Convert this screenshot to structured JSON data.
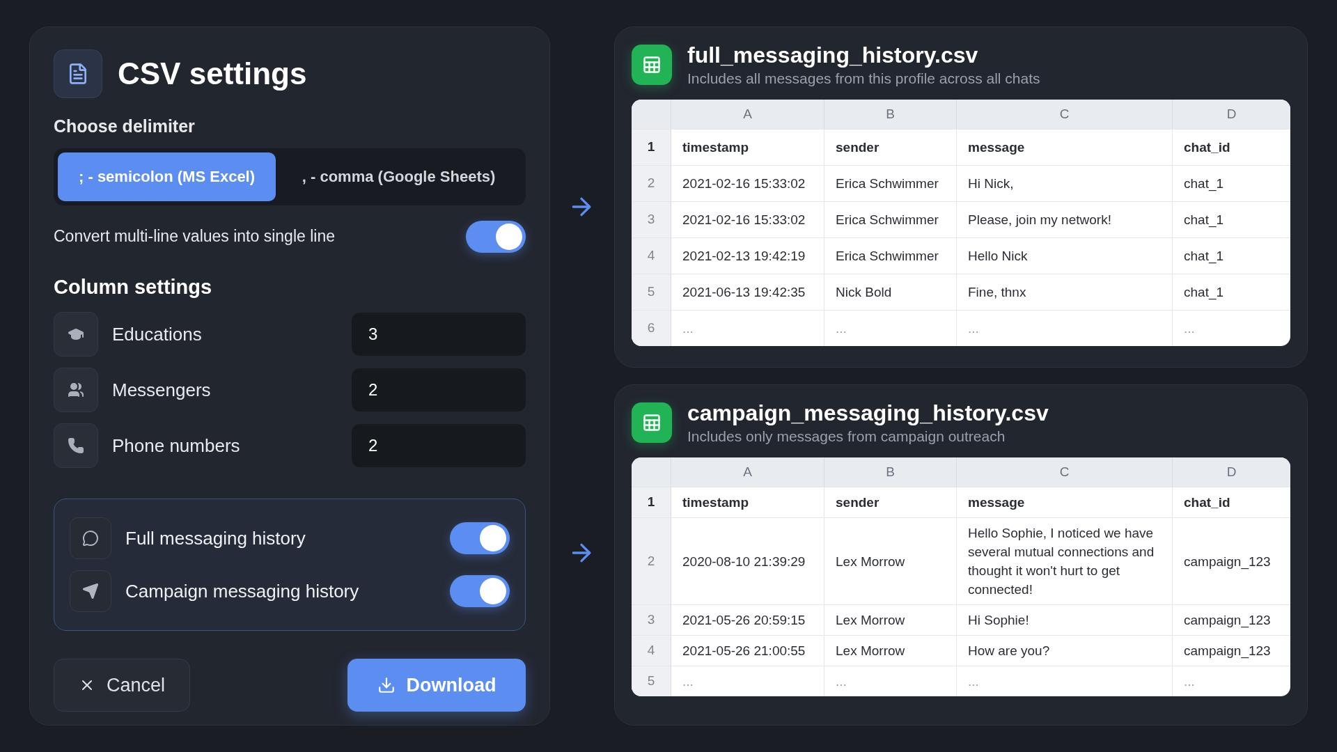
{
  "settings": {
    "title": "CSV settings",
    "delimiter_label": "Choose delimiter",
    "delimiters": [
      {
        "label": "; - semicolon (MS Excel)",
        "selected": true
      },
      {
        "label": ", - comma (Google Sheets)",
        "selected": false
      }
    ],
    "convert": {
      "label": "Convert multi-line values into single line",
      "on": true
    },
    "column_settings_title": "Column settings",
    "columns": [
      {
        "kind": "education",
        "label": "Educations",
        "value": "3"
      },
      {
        "kind": "messengers",
        "label": "Messengers",
        "value": "2"
      },
      {
        "kind": "phone",
        "label": "Phone numbers",
        "value": "2"
      }
    ],
    "exports": [
      {
        "kind": "chat",
        "label": "Full messaging history",
        "on": true
      },
      {
        "kind": "campaign",
        "label": "Campaign messaging history",
        "on": true
      }
    ],
    "cancel": "Cancel",
    "download": "Download"
  },
  "files": [
    {
      "name": "full_messaging_history.csv",
      "description": "Includes all messages from this profile across all chats",
      "columns": [
        "A",
        "B",
        "C",
        "D"
      ],
      "rows": [
        {
          "number": "1",
          "kind": "header",
          "cells": [
            "timestamp",
            "sender",
            "message",
            "chat_id"
          ]
        },
        {
          "number": "2",
          "kind": "data",
          "cells": [
            "2021-02-16 15:33:02",
            "Erica Schwimmer",
            "Hi Nick,",
            "chat_1"
          ]
        },
        {
          "number": "3",
          "kind": "data",
          "cells": [
            "2021-02-16 15:33:02",
            "Erica Schwimmer",
            "Please, join my network!",
            "chat_1"
          ]
        },
        {
          "number": "4",
          "kind": "data",
          "cells": [
            "2021-02-13 19:42:19",
            "Erica Schwimmer",
            "Hello Nick",
            "chat_1"
          ]
        },
        {
          "number": "5",
          "kind": "data",
          "cells": [
            "2021-06-13 19:42:35",
            "Nick Bold",
            "Fine, thnx",
            "chat_1"
          ]
        },
        {
          "number": "6",
          "kind": "more",
          "cells": [
            "...",
            "...",
            "...",
            "..."
          ]
        }
      ]
    },
    {
      "name": "campaign_messaging_history.csv",
      "description": "Includes only messages from campaign outreach",
      "columns": [
        "A",
        "B",
        "C",
        "D"
      ],
      "rows": [
        {
          "number": "1",
          "kind": "header",
          "cells": [
            "timestamp",
            "sender",
            "message",
            "chat_id"
          ]
        },
        {
          "number": "2",
          "kind": "data",
          "cells": [
            "2020-08-10 21:39:29",
            "Lex Morrow",
            "Hello Sophie, I noticed we have several mutual connections and thought it won't hurt to get connected!",
            "campaign_123"
          ]
        },
        {
          "number": "3",
          "kind": "data",
          "cells": [
            "2021-05-26 20:59:15",
            "Lex Morrow",
            "Hi Sophie!",
            "campaign_123"
          ]
        },
        {
          "number": "4",
          "kind": "data",
          "cells": [
            "2021-05-26 21:00:55",
            "Lex Morrow",
            "How are you?",
            "campaign_123"
          ]
        },
        {
          "number": "5",
          "kind": "more",
          "cells": [
            "...",
            "...",
            "...",
            "..."
          ]
        }
      ]
    }
  ]
}
